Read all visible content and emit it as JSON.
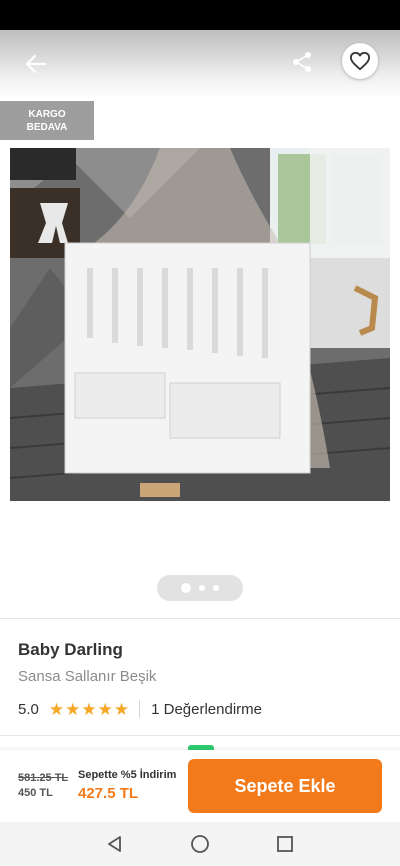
{
  "header": {
    "back_icon": "arrow-left-icon",
    "share_icon": "share-icon",
    "favorite_icon": "heart-outline-icon"
  },
  "badge": {
    "line1": "KARGO",
    "line2": "BEDAVA"
  },
  "gallery": {
    "page_count": 3,
    "active_index": 0
  },
  "product": {
    "brand": "Baby Darling",
    "name": "Sansa Sallanır Beşik",
    "rating": "5.0",
    "rating_stars": 5,
    "reviews": "1 Değerlendirme"
  },
  "price_bar": {
    "old_price": "581.25 TL",
    "base_price": "450 TL",
    "promo_label": "Sepette %5 İndirim",
    "final_price": "427.5 TL",
    "add_to_cart": "Sepete Ekle"
  },
  "colors": {
    "accent": "#f27a1a",
    "star": "#f5a623",
    "badge": "#9e9e9e"
  },
  "system_nav": {
    "back": "triangle-back-icon",
    "home": "circle-home-icon",
    "recents": "square-recents-icon"
  }
}
